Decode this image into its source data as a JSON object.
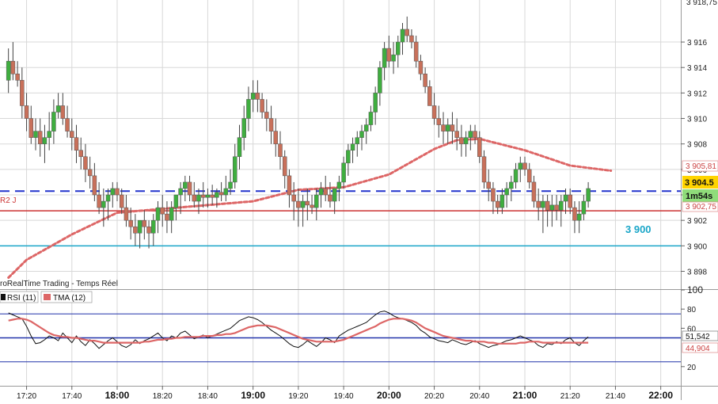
{
  "watermark": "roRealTime Trading - Temps Réel",
  "colors": {
    "up": "#3fae3f",
    "down": "#c8705a",
    "wick": "#444444",
    "dashed_blue": "#2233cc",
    "red_line": "#cc3333",
    "cyan_line": "#1aa6c8",
    "ma": "#dd6666",
    "rsi": "#111111",
    "tma": "#dd6666",
    "grid": "#d8d8d8",
    "price_tag": "#ffd400",
    "timer_tag": "#8fdc7a"
  },
  "chart_data": [
    {
      "type": "candlestick",
      "title": "",
      "x": [
        "17:12",
        "17:14",
        "17:16",
        "17:18",
        "17:20",
        "17:22",
        "17:24",
        "17:26",
        "17:28",
        "17:30",
        "17:32",
        "17:34",
        "17:36",
        "17:38",
        "17:40",
        "17:42",
        "17:44",
        "17:46",
        "17:48",
        "17:50",
        "17:52",
        "17:54",
        "17:56",
        "17:58",
        "18:00",
        "18:02",
        "18:04",
        "18:06",
        "18:08",
        "18:10",
        "18:12",
        "18:14",
        "18:16",
        "18:18",
        "18:20",
        "18:22",
        "18:24",
        "18:26",
        "18:28",
        "18:30",
        "18:32",
        "18:34",
        "18:36",
        "18:38",
        "18:40",
        "18:42",
        "18:44",
        "18:46",
        "18:48",
        "18:50",
        "18:52",
        "18:54",
        "18:56",
        "18:58",
        "19:00",
        "19:02",
        "19:04",
        "19:06",
        "19:08",
        "19:10",
        "19:12",
        "19:14",
        "19:16",
        "19:18",
        "19:20",
        "19:22",
        "19:24",
        "19:26",
        "19:28",
        "19:30",
        "19:32",
        "19:34",
        "19:36",
        "19:38",
        "19:40",
        "19:42",
        "19:44",
        "19:46",
        "19:48",
        "19:50",
        "19:52",
        "19:54",
        "19:56",
        "19:58",
        "20:00",
        "20:02",
        "20:04",
        "20:06",
        "20:08",
        "20:10",
        "20:12",
        "20:14",
        "20:16",
        "20:18",
        "20:20",
        "20:22",
        "20:24",
        "20:26",
        "20:28",
        "20:30",
        "20:32",
        "20:34",
        "20:36",
        "20:38",
        "20:40",
        "20:42",
        "20:44",
        "20:46",
        "20:48",
        "20:50",
        "20:52",
        "20:54",
        "20:56",
        "20:58",
        "21:00",
        "21:02",
        "21:04",
        "21:06",
        "21:08",
        "21:10",
        "21:12",
        "21:14",
        "21:16",
        "21:18",
        "21:20",
        "21:22",
        "21:24",
        "21:26",
        "21:28",
        "21:30",
        "21:32",
        "21:34",
        "21:36",
        "21:38"
      ],
      "open": [
        3913.0,
        3914.5,
        3913.5,
        3913.0,
        3911.0,
        3910.0,
        3908.5,
        3909.0,
        3908.0,
        3908.5,
        3909.0,
        3910.5,
        3911.0,
        3910.0,
        3909.0,
        3908.5,
        3907.5,
        3907.0,
        3906.0,
        3905.5,
        3904.0,
        3903.0,
        3903.5,
        3904.0,
        3904.5,
        3904.0,
        3903.0,
        3902.0,
        3901.5,
        3901.0,
        3902.0,
        3901.5,
        3901.0,
        3902.0,
        3903.0,
        3902.5,
        3902.0,
        3903.0,
        3904.0,
        3904.5,
        3905.0,
        3904.0,
        3903.5,
        3904.0,
        3903.8,
        3904.0,
        3903.8,
        3904.2,
        3904.0,
        3904.5,
        3905.0,
        3907.0,
        3908.5,
        3910.0,
        3911.5,
        3912.0,
        3911.5,
        3910.5,
        3910.0,
        3909.0,
        3908.0,
        3907.0,
        3905.5,
        3904.0,
        3903.5,
        3903.0,
        3903.5,
        3903.2,
        3903.0,
        3904.0,
        3904.5,
        3904.0,
        3903.5,
        3904.5,
        3905.0,
        3906.5,
        3907.5,
        3908.0,
        3908.5,
        3909.0,
        3909.5,
        3910.5,
        3912.0,
        3914.0,
        3915.5,
        3914.5,
        3915.0,
        3916.0,
        3917.0,
        3916.5,
        3916.0,
        3914.5,
        3913.5,
        3912.5,
        3911.0,
        3910.0,
        3909.5,
        3909.0,
        3909.5,
        3909.0,
        3908.5,
        3908.0,
        3908.5,
        3909.0,
        3908.5,
        3907.0,
        3905.0,
        3904.5,
        3903.5,
        3903.0,
        3904.0,
        3904.5,
        3905.0,
        3906.0,
        3906.5,
        3906.0,
        3905.0,
        3903.5,
        3903.0,
        3903.5,
        3902.8,
        3903.2,
        3902.8,
        3903.5,
        3904.0,
        3903.0,
        3902.0,
        3902.5,
        3903.5
      ],
      "high": [
        3915.5,
        3916.0,
        3914.5,
        3914.0,
        3912.0,
        3911.0,
        3910.0,
        3910.0,
        3909.5,
        3910.5,
        3911.5,
        3912.0,
        3912.0,
        3911.0,
        3910.0,
        3909.5,
        3908.5,
        3908.0,
        3907.0,
        3906.5,
        3905.0,
        3904.5,
        3904.5,
        3905.0,
        3905.0,
        3904.5,
        3904.0,
        3903.0,
        3902.5,
        3902.0,
        3902.8,
        3902.0,
        3902.5,
        3903.5,
        3904.0,
        3903.5,
        3903.5,
        3904.0,
        3905.0,
        3905.5,
        3905.5,
        3905.0,
        3904.5,
        3905.0,
        3904.5,
        3904.8,
        3904.5,
        3905.0,
        3905.5,
        3906.0,
        3908.0,
        3909.5,
        3911.0,
        3912.5,
        3913.0,
        3913.0,
        3912.0,
        3911.5,
        3911.0,
        3910.0,
        3909.0,
        3907.5,
        3906.0,
        3905.0,
        3904.5,
        3904.0,
        3904.5,
        3904.0,
        3904.5,
        3905.0,
        3905.5,
        3905.0,
        3904.5,
        3905.5,
        3907.0,
        3908.0,
        3908.5,
        3909.0,
        3909.5,
        3910.0,
        3911.0,
        3912.5,
        3914.5,
        3916.0,
        3916.5,
        3916.0,
        3916.5,
        3917.5,
        3918.0,
        3917.0,
        3916.5,
        3915.0,
        3914.0,
        3913.0,
        3912.0,
        3911.0,
        3910.5,
        3910.0,
        3910.5,
        3910.0,
        3909.5,
        3909.0,
        3909.5,
        3909.5,
        3909.0,
        3907.5,
        3906.0,
        3905.0,
        3904.0,
        3904.5,
        3905.0,
        3905.5,
        3906.5,
        3907.0,
        3907.0,
        3906.5,
        3905.5,
        3904.5,
        3904.0,
        3904.0,
        3904.0,
        3904.0,
        3904.0,
        3904.5,
        3904.5,
        3903.5,
        3903.5,
        3904.0,
        3905.0
      ],
      "low": [
        3912.0,
        3913.0,
        3912.5,
        3910.0,
        3909.0,
        3908.0,
        3907.5,
        3907.0,
        3906.5,
        3907.5,
        3908.0,
        3910.0,
        3909.5,
        3908.5,
        3907.5,
        3906.5,
        3906.0,
        3905.0,
        3904.5,
        3903.5,
        3902.5,
        3901.5,
        3902.0,
        3903.0,
        3903.5,
        3902.5,
        3901.5,
        3900.5,
        3900.0,
        3899.8,
        3900.5,
        3899.8,
        3900.0,
        3901.0,
        3901.5,
        3901.0,
        3901.0,
        3902.0,
        3902.5,
        3903.5,
        3903.5,
        3903.0,
        3902.5,
        3903.0,
        3903.0,
        3903.2,
        3903.0,
        3903.5,
        3903.5,
        3904.0,
        3904.5,
        3906.0,
        3907.5,
        3909.0,
        3910.5,
        3910.5,
        3910.0,
        3909.0,
        3908.0,
        3907.0,
        3906.0,
        3904.5,
        3903.0,
        3902.0,
        3901.5,
        3901.5,
        3902.0,
        3902.5,
        3902.0,
        3903.0,
        3903.5,
        3903.0,
        3902.5,
        3903.5,
        3904.5,
        3905.5,
        3906.5,
        3907.0,
        3907.5,
        3908.0,
        3909.0,
        3909.5,
        3911.0,
        3913.0,
        3914.0,
        3913.5,
        3914.0,
        3915.0,
        3916.0,
        3915.5,
        3914.0,
        3913.0,
        3912.0,
        3911.0,
        3909.5,
        3908.5,
        3908.0,
        3908.0,
        3908.0,
        3907.5,
        3907.0,
        3907.0,
        3907.5,
        3908.0,
        3906.5,
        3904.5,
        3903.5,
        3902.5,
        3902.5,
        3902.5,
        3903.0,
        3903.5,
        3904.5,
        3905.0,
        3905.5,
        3904.5,
        3903.0,
        3902.0,
        3901.0,
        3901.5,
        3901.5,
        3902.0,
        3901.5,
        3902.5,
        3902.5,
        3901.0,
        3901.0,
        3902.0,
        3903.0
      ],
      "close": [
        3914.5,
        3913.5,
        3913.0,
        3911.0,
        3910.0,
        3908.5,
        3909.0,
        3908.0,
        3908.5,
        3909.0,
        3910.5,
        3911.0,
        3910.0,
        3909.0,
        3908.5,
        3907.5,
        3907.0,
        3906.0,
        3905.5,
        3904.0,
        3903.0,
        3903.5,
        3904.0,
        3904.5,
        3904.0,
        3903.0,
        3902.0,
        3901.5,
        3901.0,
        3902.0,
        3901.5,
        3901.0,
        3902.0,
        3903.0,
        3902.5,
        3902.0,
        3903.0,
        3904.0,
        3904.5,
        3905.0,
        3904.0,
        3903.5,
        3904.0,
        3903.8,
        3904.0,
        3903.8,
        3904.2,
        3904.0,
        3904.5,
        3905.0,
        3907.0,
        3908.5,
        3910.0,
        3911.5,
        3912.0,
        3911.5,
        3910.5,
        3910.0,
        3909.0,
        3908.0,
        3907.0,
        3905.5,
        3904.0,
        3903.5,
        3903.0,
        3903.5,
        3903.2,
        3903.0,
        3904.0,
        3904.5,
        3904.0,
        3903.5,
        3904.5,
        3905.0,
        3906.5,
        3907.5,
        3908.0,
        3908.5,
        3909.0,
        3909.5,
        3910.5,
        3912.0,
        3914.0,
        3915.5,
        3914.5,
        3915.0,
        3916.0,
        3917.0,
        3916.5,
        3916.0,
        3914.5,
        3913.5,
        3912.5,
        3911.0,
        3910.0,
        3909.5,
        3909.0,
        3909.5,
        3909.0,
        3908.5,
        3908.0,
        3908.5,
        3909.0,
        3908.5,
        3907.0,
        3905.0,
        3904.5,
        3903.5,
        3903.0,
        3904.0,
        3904.5,
        3905.0,
        3906.0,
        3906.5,
        3906.0,
        3905.0,
        3903.5,
        3903.0,
        3903.5,
        3902.8,
        3903.2,
        3902.8,
        3903.5,
        3904.0,
        3903.0,
        3902.0,
        3902.5,
        3903.5,
        3904.5
      ],
      "moving_average": {
        "x": [
          "17:12",
          "17:20",
          "17:40",
          "18:00",
          "18:20",
          "18:40",
          "19:00",
          "19:20",
          "19:40",
          "20:00",
          "20:20",
          "20:30",
          "20:40",
          "21:00",
          "21:20",
          "21:38"
        ],
        "values": [
          3897.5,
          3898.9,
          3900.9,
          3902.6,
          3902.9,
          3903.2,
          3903.5,
          3904.4,
          3904.6,
          3905.6,
          3907.6,
          3908.3,
          3908.4,
          3907.5,
          3906.3,
          3905.9
        ]
      },
      "horizontal_lines": [
        {
          "value": 3904.3,
          "style": "dashed",
          "color_key": "dashed_blue"
        },
        {
          "value": 3902.75,
          "style": "solid",
          "color_key": "red_line"
        },
        {
          "value": 3900.0,
          "style": "solid",
          "color_key": "cyan_line"
        }
      ],
      "ylim": [
        3896.6,
        3919.3
      ],
      "y_ticks": [
        "3 898",
        "3 900",
        "3 902",
        "3 904",
        "3 906",
        "3 908",
        "3 910",
        "3 912",
        "3 914",
        "3 916"
      ],
      "y_tick_values": [
        3898,
        3900,
        3902,
        3904,
        3906,
        3908,
        3910,
        3912,
        3914,
        3916
      ],
      "top_partial_label": "3 918,75",
      "price_tags": {
        "current": "3 904.5",
        "timer": "1m54s",
        "upper": "3 905,81",
        "lower": "3 902,75"
      },
      "level_label": "3 900",
      "left_label": "R2 J"
    },
    {
      "type": "line",
      "legend": [
        {
          "name": "RSI (11)",
          "color_key": "rsi"
        },
        {
          "name": "TMA (12)",
          "color_key": "tma"
        }
      ],
      "ylim": [
        0,
        100
      ],
      "y_ticks": [
        "100",
        "80",
        "60",
        "20"
      ],
      "y_tick_values": [
        100,
        80,
        60,
        20
      ],
      "levels": [
        75,
        50,
        25
      ],
      "value_tags": {
        "rsi": "51,542",
        "tma": "44,904"
      },
      "series": [
        {
          "key": "rsi",
          "values": [
            76,
            74,
            72,
            70,
            62,
            52,
            44,
            45,
            48,
            52,
            50,
            47,
            55,
            50,
            45,
            52,
            46,
            42,
            48,
            44,
            39,
            43,
            47,
            50,
            46,
            42,
            40,
            43,
            48,
            44,
            47,
            49,
            52,
            55,
            50,
            47,
            52,
            50,
            55,
            57,
            53,
            49,
            51,
            53,
            50,
            52,
            54,
            56,
            58,
            60,
            64,
            68,
            70,
            72,
            71,
            69,
            66,
            62,
            58,
            55,
            52,
            48,
            44,
            41,
            40,
            43,
            47,
            44,
            41,
            45,
            50,
            48,
            45,
            52,
            55,
            58,
            60,
            62,
            64,
            66,
            70,
            74,
            77,
            78,
            76,
            73,
            71,
            70,
            68,
            66,
            63,
            58,
            55,
            51,
            49,
            47,
            46,
            45,
            48,
            46,
            44,
            43,
            45,
            47,
            44,
            42,
            40,
            42,
            43,
            45,
            47,
            48,
            50,
            52,
            50,
            48,
            46,
            42,
            40,
            44,
            43,
            46,
            44,
            48,
            50,
            45,
            42,
            47,
            51
          ]
        },
        {
          "key": "tma",
          "values": [
            68,
            69,
            70,
            70,
            69,
            67,
            64,
            61,
            58,
            55,
            53,
            52,
            51,
            51,
            50,
            50,
            49,
            48,
            47,
            47,
            46,
            45,
            45,
            45,
            45,
            45,
            45,
            45,
            45,
            45,
            46,
            46,
            47,
            48,
            48,
            49,
            49,
            50,
            50,
            51,
            51,
            51,
            51,
            52,
            52,
            52,
            53,
            53,
            54,
            54,
            55,
            57,
            59,
            61,
            62,
            63,
            63,
            63,
            62,
            61,
            59,
            57,
            55,
            53,
            51,
            49,
            48,
            47,
            46,
            46,
            46,
            46,
            46,
            47,
            48,
            50,
            52,
            54,
            56,
            58,
            60,
            62,
            65,
            67,
            69,
            70,
            70,
            70,
            69,
            68,
            66,
            63,
            60,
            58,
            56,
            54,
            52,
            51,
            50,
            49,
            48,
            47,
            47,
            46,
            46,
            46,
            45,
            45,
            44,
            44,
            44,
            44,
            44,
            45,
            45,
            46,
            46,
            46,
            45,
            45,
            45,
            45,
            45,
            45,
            45,
            45,
            45,
            45,
            45
          ]
        }
      ]
    }
  ],
  "x_axis": {
    "ticks": [
      "17:20",
      "17:40",
      "18:00",
      "18:20",
      "18:40",
      "19:00",
      "19:20",
      "19:40",
      "20:00",
      "20:20",
      "20:40",
      "21:00",
      "21:20",
      "21:40",
      "22:00"
    ],
    "bold_ticks": [
      "18:00",
      "19:00",
      "20:00",
      "21:00",
      "22:00"
    ]
  }
}
